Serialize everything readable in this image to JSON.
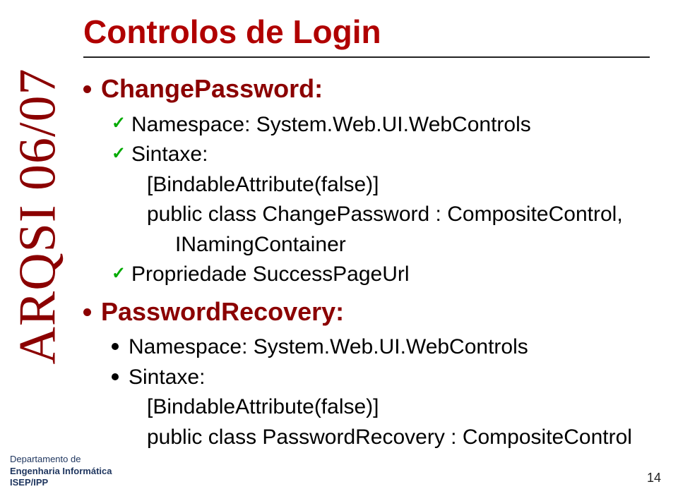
{
  "sidebar": {
    "label": "ARQSI 06/07"
  },
  "title": "Controlos de Login",
  "sections": [
    {
      "heading": "ChangePassword:",
      "items": [
        {
          "label": "Namespace: System.Web.UI.WebControls"
        },
        {
          "label": "Sintaxe:",
          "code": [
            "[BindableAttribute(false)]",
            "public class ChangePassword : CompositeControl,",
            "INamingContainer"
          ]
        },
        {
          "label": "Propriedade SuccessPageUrl"
        }
      ]
    },
    {
      "heading": "PasswordRecovery:",
      "sub": [
        {
          "label": "Namespace: System.Web.UI.WebControls"
        },
        {
          "label": "Sintaxe:",
          "code": [
            "[BindableAttribute(false)]",
            "public class PasswordRecovery : CompositeControl"
          ]
        }
      ]
    }
  ],
  "footer": {
    "line1": "Departamento de",
    "line2": "Engenharia Informática",
    "line3": "ISEP/IPP"
  },
  "page_number": "14"
}
